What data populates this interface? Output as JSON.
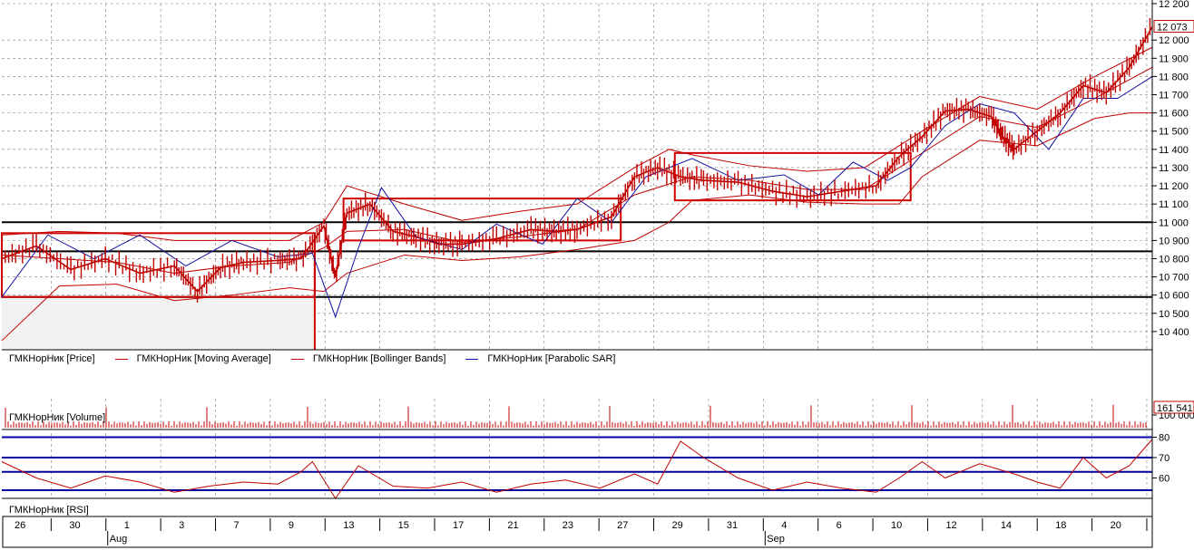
{
  "legend": {
    "price": "ГМКНорНик [Price]",
    "ma": "ГМКНорНик [Moving Average]",
    "bb": "ГМКНорНик [Bollinger Bands]",
    "sar": "ГМКНорНик [Parabolic SAR]",
    "volume": "ГМКНорНик [Volume]",
    "rsi": "ГМКНорНик [RSI]"
  },
  "colors": {
    "price": "#c00000",
    "ma": "#c00000",
    "bb": "#c00000",
    "sar": "#1010a0",
    "grid": "#808080",
    "hline": "#000000",
    "rsi_line": "#0000a0"
  },
  "chart_data": [
    {
      "type": "line",
      "name": "price",
      "ylim": [
        10300,
        12200
      ],
      "yticks": [
        10400,
        10500,
        10600,
        10700,
        10800,
        10900,
        11000,
        11100,
        11200,
        11300,
        11400,
        11500,
        11600,
        11700,
        11800,
        11900,
        12000,
        12200
      ],
      "last_label": "12 073",
      "hlines": [
        11000,
        10840,
        10590
      ],
      "boxes": [
        {
          "x0": 0.0,
          "x1": 0.272,
          "y0": 10940,
          "y1": 10590
        },
        {
          "x0": 0.297,
          "x1": 0.538,
          "y0": 11130,
          "y1": 10900
        },
        {
          "x0": 0.585,
          "x1": 0.79,
          "y0": 11380,
          "y1": 11120
        }
      ],
      "series": [
        {
          "name": "Price",
          "x": [
            0,
            0.03,
            0.06,
            0.09,
            0.12,
            0.15,
            0.17,
            0.19,
            0.21,
            0.24,
            0.26,
            0.28,
            0.29,
            0.3,
            0.32,
            0.34,
            0.36,
            0.38,
            0.4,
            0.43,
            0.46,
            0.48,
            0.5,
            0.53,
            0.55,
            0.57,
            0.59,
            0.61,
            0.64,
            0.67,
            0.7,
            0.73,
            0.76,
            0.78,
            0.8,
            0.82,
            0.84,
            0.86,
            0.87,
            0.88,
            0.9,
            0.92,
            0.94,
            0.96,
            0.98,
            1.0
          ],
          "y": [
            10800,
            10870,
            10740,
            10800,
            10720,
            10760,
            10620,
            10750,
            10780,
            10790,
            10800,
            10980,
            10700,
            11050,
            11100,
            10950,
            10920,
            10880,
            10880,
            10910,
            10960,
            10950,
            10960,
            11030,
            11250,
            11300,
            11250,
            11230,
            11220,
            11170,
            11140,
            11170,
            11200,
            11360,
            11470,
            11610,
            11620,
            11580,
            11470,
            11400,
            11500,
            11600,
            11750,
            11710,
            11850,
            12073
          ]
        },
        {
          "name": "Moving Average",
          "x": [
            0,
            0.05,
            0.1,
            0.15,
            0.2,
            0.25,
            0.28,
            0.3,
            0.35,
            0.4,
            0.45,
            0.5,
            0.55,
            0.6,
            0.65,
            0.7,
            0.75,
            0.8,
            0.85,
            0.9,
            0.95,
            1.0
          ],
          "y": [
            10820,
            10800,
            10780,
            10720,
            10760,
            10780,
            10860,
            10950,
            10960,
            10890,
            10920,
            10960,
            11150,
            11250,
            11230,
            11180,
            11180,
            11380,
            11580,
            11520,
            11680,
            11850
          ]
        },
        {
          "name": "Bollinger Upper",
          "x": [
            0,
            0.05,
            0.1,
            0.15,
            0.2,
            0.25,
            0.28,
            0.3,
            0.35,
            0.4,
            0.45,
            0.5,
            0.55,
            0.58,
            0.6,
            0.65,
            0.7,
            0.75,
            0.8,
            0.85,
            0.9,
            0.95,
            1.0
          ],
          "y": [
            10930,
            10950,
            10940,
            10900,
            10900,
            10900,
            11000,
            11200,
            11100,
            11010,
            11060,
            11100,
            11300,
            11400,
            11370,
            11310,
            11280,
            11300,
            11500,
            11690,
            11620,
            11800,
            11960
          ]
        },
        {
          "name": "Bollinger Lower",
          "x": [
            0,
            0.05,
            0.1,
            0.15,
            0.2,
            0.25,
            0.28,
            0.3,
            0.35,
            0.4,
            0.45,
            0.5,
            0.55,
            0.58,
            0.6,
            0.65,
            0.7,
            0.75,
            0.78,
            0.8,
            0.85,
            0.9,
            0.95,
            0.98,
            1.0
          ],
          "y": [
            10350,
            10650,
            10660,
            10570,
            10600,
            10640,
            10620,
            10720,
            10820,
            10790,
            10810,
            10850,
            10900,
            11000,
            11120,
            11150,
            11110,
            11100,
            11100,
            11250,
            11450,
            11420,
            11570,
            11600,
            11600
          ]
        },
        {
          "name": "Parabolic SAR",
          "x": [
            0,
            0.04,
            0.08,
            0.12,
            0.16,
            0.2,
            0.24,
            0.27,
            0.29,
            0.31,
            0.33,
            0.36,
            0.4,
            0.43,
            0.47,
            0.5,
            0.53,
            0.56,
            0.6,
            0.64,
            0.68,
            0.71,
            0.74,
            0.77,
            0.79,
            0.82,
            0.85,
            0.88,
            0.91,
            0.94,
            0.97,
            1.0
          ],
          "y": [
            10590,
            10930,
            10800,
            10930,
            10760,
            10900,
            10810,
            10830,
            10480,
            10860,
            11190,
            10920,
            10850,
            10990,
            10880,
            11130,
            11000,
            11250,
            11350,
            11230,
            11260,
            11150,
            11330,
            11230,
            11300,
            11530,
            11650,
            11600,
            11400,
            11680,
            11680,
            11800
          ]
        }
      ]
    },
    {
      "type": "bar",
      "name": "volume",
      "last_label": "161 541",
      "tick": "100 000"
    },
    {
      "type": "line",
      "name": "RSI",
      "ylim": [
        50,
        82
      ],
      "yticks": [
        60,
        70,
        80
      ],
      "hlines": [
        80,
        70,
        63,
        54
      ],
      "series": [
        {
          "name": "RSI",
          "x": [
            0,
            0.03,
            0.06,
            0.09,
            0.12,
            0.15,
            0.18,
            0.21,
            0.24,
            0.26,
            0.27,
            0.29,
            0.31,
            0.34,
            0.37,
            0.4,
            0.43,
            0.46,
            0.49,
            0.52,
            0.55,
            0.57,
            0.59,
            0.61,
            0.64,
            0.67,
            0.7,
            0.73,
            0.76,
            0.78,
            0.8,
            0.82,
            0.85,
            0.88,
            0.9,
            0.92,
            0.94,
            0.96,
            0.98,
            1.0
          ],
          "y": [
            68,
            60,
            55,
            61,
            58,
            53,
            56,
            58,
            57,
            63,
            68,
            49,
            66,
            56,
            55,
            58,
            53,
            57,
            59,
            55,
            62,
            57,
            78,
            70,
            60,
            54,
            58,
            55,
            53,
            60,
            68,
            60,
            67,
            62,
            58,
            55,
            70,
            60,
            66,
            79
          ]
        }
      ]
    }
  ],
  "xaxis": {
    "days": [
      "26",
      "30",
      "1",
      "3",
      "7",
      "9",
      "13",
      "15",
      "17",
      "21",
      "23",
      "27",
      "29",
      "31",
      "4",
      "6",
      "10",
      "12",
      "14",
      "18",
      "20"
    ],
    "months": [
      {
        "label": "Aug",
        "index": 2
      },
      {
        "label": "Sep",
        "index": 14
      }
    ]
  }
}
